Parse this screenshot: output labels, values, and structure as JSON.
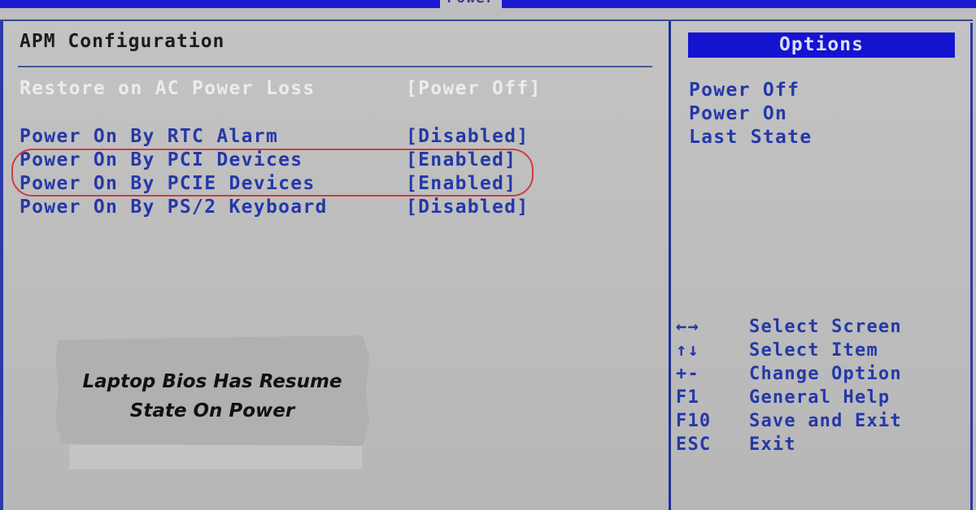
{
  "header": {
    "active_tab": "Power"
  },
  "main": {
    "section_title": "APM Configuration",
    "settings": [
      {
        "label": "Restore on AC Power Loss",
        "value": "[Power Off]",
        "state": "selected"
      },
      {
        "label": "Power On By RTC Alarm",
        "value": "[Disabled]",
        "state": "normal"
      },
      {
        "label": "Power On By PCI Devices",
        "value": "[Enabled]",
        "state": "highlighted"
      },
      {
        "label": "Power On By PCIE Devices",
        "value": "[Enabled]",
        "state": "highlighted"
      },
      {
        "label": "Power On By PS/2 Keyboard",
        "value": "[Disabled]",
        "state": "normal"
      }
    ]
  },
  "sidebar": {
    "options_title": "Options",
    "options": [
      "Power Off",
      "Power On",
      "Last State"
    ],
    "help": [
      {
        "key": "←→",
        "desc": "Select Screen"
      },
      {
        "key": "↑↓",
        "desc": "Select Item"
      },
      {
        "key": "+-",
        "desc": "Change Option"
      },
      {
        "key": "F1",
        "desc": "General Help"
      },
      {
        "key": "F10",
        "desc": "Save and Exit"
      },
      {
        "key": "ESC",
        "desc": "Exit"
      }
    ]
  },
  "overlay": {
    "caption_line1": "Laptop Bios Has Resume",
    "caption_line2": "State On Power"
  },
  "colors": {
    "bios_blue": "#1a1ad2",
    "item_text": "#2538a8",
    "annotation_red": "#d23b3b",
    "panel_gray": "#bdbdbd"
  }
}
